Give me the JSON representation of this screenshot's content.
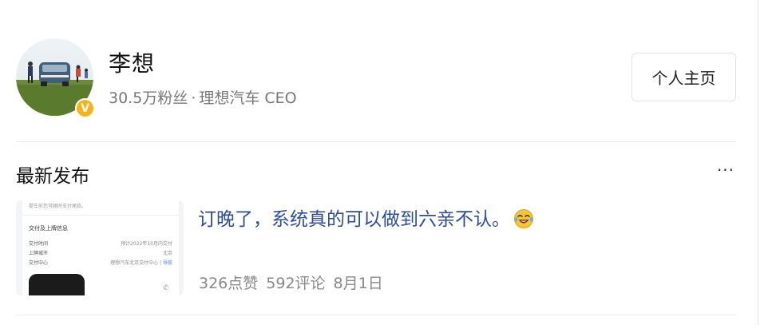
{
  "profile": {
    "name": "李想",
    "followers": "30.5万粉丝",
    "separator": "·",
    "title": "理想汽车 CEO",
    "verified_mark": "V",
    "profile_button_label": "个人主页",
    "avatar_icon": "avatar-photo",
    "accent_color": "#f5b21a"
  },
  "section": {
    "title": "最新发布",
    "more_label": "···"
  },
  "post": {
    "text": "订晚了，系统真的可以做到六亲不认。",
    "emoji_icon": "laughing-crying-emoji",
    "likes": "326点赞",
    "comments": "592评论",
    "date": "8月1日",
    "text_color": "#2b4c9c",
    "thumbnail": {
      "top_note": "提车前您可随时支付尾款。",
      "section_title": "交付及上牌信息",
      "rows": [
        {
          "label": "交付时间",
          "value": "预计2022年10月内交付",
          "link": ""
        },
        {
          "label": "上牌城市",
          "value": "北京",
          "link": ""
        },
        {
          "label": "交付中心",
          "value": "理想汽车北京交付中心 | ",
          "link": "导航"
        }
      ]
    }
  }
}
